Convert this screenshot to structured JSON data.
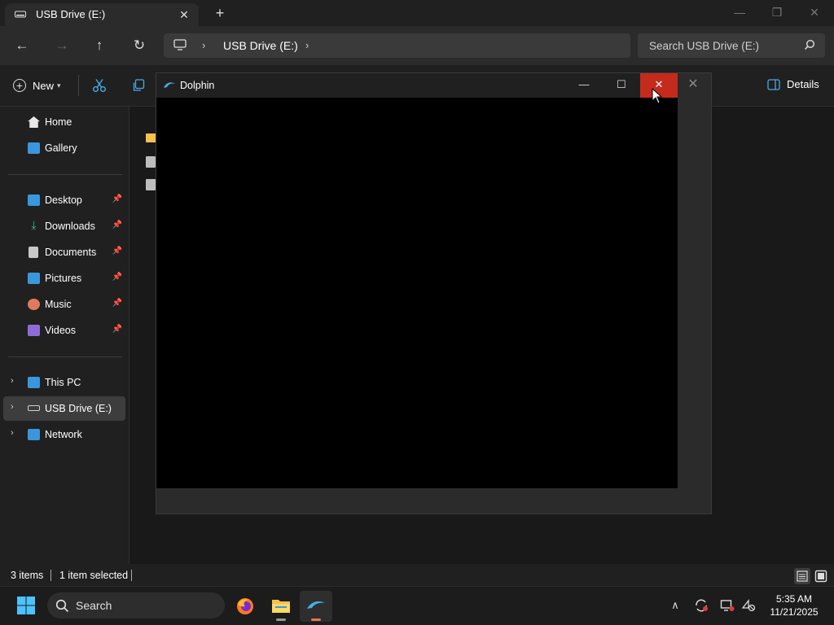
{
  "window": {
    "tab_title": "USB Drive (E:)",
    "tab_close_glyph": "✕",
    "new_tab_glyph": "+",
    "controls": {
      "minimize": "—",
      "restore": "❐",
      "close": "✕"
    }
  },
  "nav": {
    "back_glyph": "←",
    "forward_glyph": "→",
    "up_glyph": "↑",
    "refresh_glyph": "↻",
    "breadcrumb_sep": "›",
    "breadcrumb_location": "USB Drive (E:)",
    "search_placeholder": "Search USB Drive (E:)"
  },
  "toolbar": {
    "new_label": "New",
    "new_dropdown": "▾",
    "details_label": "Details"
  },
  "sidebar": {
    "quick": [
      {
        "label": "Home",
        "icon": "home-icon",
        "color": "#e8e8e8"
      },
      {
        "label": "Gallery",
        "icon": "gallery-icon",
        "color": "#3a96dd"
      }
    ],
    "pinned": [
      {
        "label": "Desktop",
        "icon": "desktop-icon",
        "color": "#3a96dd"
      },
      {
        "label": "Downloads",
        "icon": "downloads-icon",
        "color": "#41b883"
      },
      {
        "label": "Documents",
        "icon": "documents-icon",
        "color": "#c9c9c9"
      },
      {
        "label": "Pictures",
        "icon": "pictures-icon",
        "color": "#3a96dd"
      },
      {
        "label": "Music",
        "icon": "music-icon",
        "color": "#e07a5f"
      },
      {
        "label": "Videos",
        "icon": "videos-icon",
        "color": "#8e6cd8"
      }
    ],
    "pin_glyph": "📌",
    "locations": [
      {
        "label": "This PC",
        "icon": "this-pc-icon",
        "color": "#3a96dd"
      },
      {
        "label": "USB Drive (E:)",
        "icon": "usb-drive-icon",
        "color": "#cfcfcf"
      },
      {
        "label": "Network",
        "icon": "network-icon",
        "color": "#3a96dd"
      }
    ],
    "expand_glyph": "›"
  },
  "status": {
    "item_count": "3 items",
    "selection": "1 item selected"
  },
  "dolphin": {
    "title": "Dolphin",
    "controls": {
      "minimize": "—",
      "maximize": "☐",
      "close": "✕"
    },
    "outer_close": "✕"
  },
  "taskbar": {
    "search_placeholder": "Search",
    "tray_chevron": "∧",
    "time": "5:35 AM",
    "date": "11/21/2025"
  },
  "colors": {
    "accent": "#3a96dd",
    "close_red": "#c42b1c",
    "folder_yellow": "#f2c14e"
  }
}
